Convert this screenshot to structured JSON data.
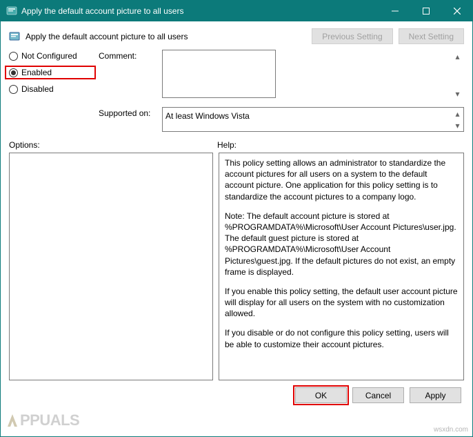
{
  "window": {
    "title": "Apply the default account picture to all users"
  },
  "header": {
    "policy_title": "Apply the default account picture to all users"
  },
  "nav": {
    "prev": "Previous Setting",
    "next": "Next Setting"
  },
  "states": {
    "not_configured": "Not Configured",
    "enabled": "Enabled",
    "disabled": "Disabled",
    "selected": "enabled"
  },
  "fields": {
    "comment_label": "Comment:",
    "comment_value": "",
    "supported_label": "Supported on:",
    "supported_value": "At least Windows Vista"
  },
  "sections": {
    "options_label": "Options:",
    "help_label": "Help:"
  },
  "help": {
    "p1": "This policy setting allows an administrator to standardize the account pictures for all users on a system to the default account picture. One application for this policy setting is to standardize the account pictures to a company logo.",
    "p2": "Note: The default account picture is stored at %PROGRAMDATA%\\Microsoft\\User Account Pictures\\user.jpg. The default guest picture is stored at %PROGRAMDATA%\\Microsoft\\User Account Pictures\\guest.jpg. If the default pictures do not exist, an empty frame is displayed.",
    "p3": "If you enable this policy setting, the default user account picture will display for all users on the system with no customization allowed.",
    "p4": "If you disable or do not configure this policy setting, users will be able to customize their account pictures."
  },
  "footer": {
    "ok": "OK",
    "cancel": "Cancel",
    "apply": "Apply"
  },
  "watermark": {
    "brand": "PPUALS",
    "source": "wsxdn.com"
  }
}
